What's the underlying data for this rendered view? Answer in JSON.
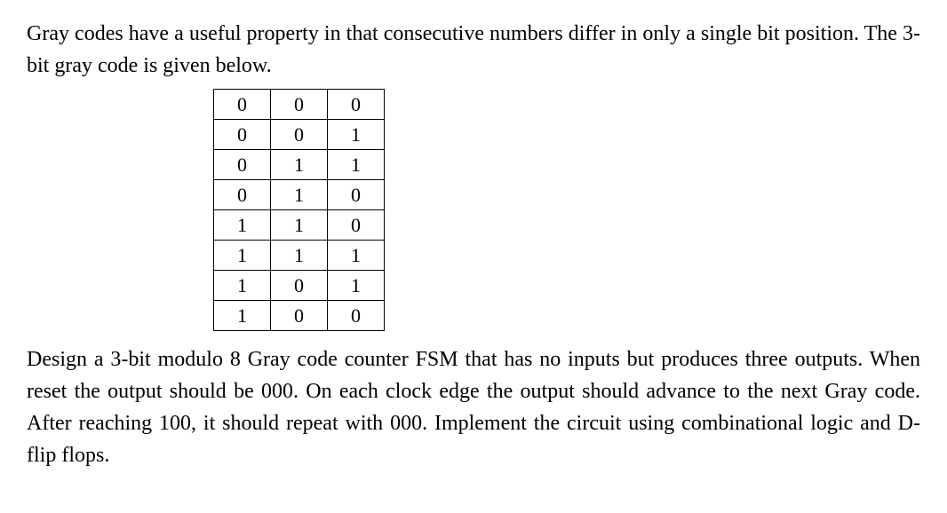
{
  "paragraph1": "Gray codes have a useful property in that consecutive numbers differ in only a single bit position. The 3-bit gray code is given below.",
  "table": {
    "rows": [
      [
        "0",
        "0",
        "0"
      ],
      [
        "0",
        "0",
        "1"
      ],
      [
        "0",
        "1",
        "1"
      ],
      [
        "0",
        "1",
        "0"
      ],
      [
        "1",
        "1",
        "0"
      ],
      [
        "1",
        "1",
        "1"
      ],
      [
        "1",
        "0",
        "1"
      ],
      [
        "1",
        "0",
        "0"
      ]
    ]
  },
  "paragraph2": "Design a 3-bit modulo 8 Gray code counter FSM that has no inputs but produces three outputs. When reset the output should be 000. On each clock edge the output should advance to the next Gray code. After reaching 100, it should repeat with 000. Implement the circuit using combinational logic and D-flip flops."
}
